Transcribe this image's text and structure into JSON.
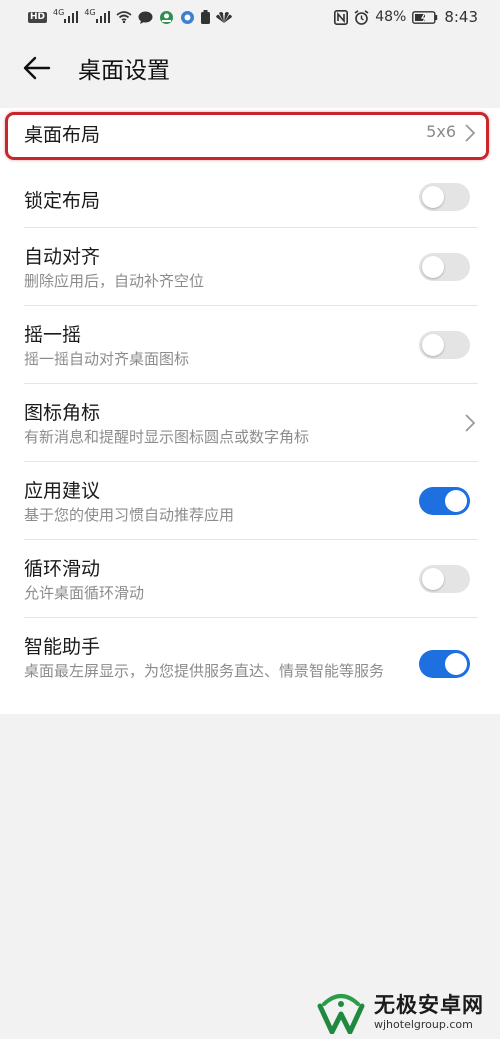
{
  "status_bar": {
    "left_icons": [
      "hd-icon",
      "signal-4g-icon",
      "signal-4g-icon",
      "wifi-icon",
      "chat-icon",
      "app-icon",
      "app-icon",
      "battery-saver-icon",
      "huawei-icon"
    ],
    "hd": "HD",
    "net1": "4G",
    "net2": "4G",
    "battery_percent": "48%",
    "time": "8:43"
  },
  "header": {
    "title": "桌面设置"
  },
  "settings": {
    "items": [
      {
        "label": "桌面布局",
        "value": "5x6",
        "control": "chevron"
      },
      {
        "label": "锁定布局",
        "control": "toggle",
        "on": false
      },
      {
        "label": "自动对齐",
        "desc": "删除应用后，自动补齐空位",
        "control": "toggle",
        "on": false
      },
      {
        "label": "摇一摇",
        "desc": "摇一摇自动对齐桌面图标",
        "control": "toggle",
        "on": false
      },
      {
        "label": "图标角标",
        "desc": "有新消息和提醒时显示图标圆点或数字角标",
        "control": "chevron"
      },
      {
        "label": "应用建议",
        "desc": "基于您的使用习惯自动推荐应用",
        "control": "toggle",
        "on": true
      },
      {
        "label": "循环滑动",
        "desc": "允许桌面循环滑动",
        "control": "toggle",
        "on": false
      },
      {
        "label": "智能助手",
        "desc": "桌面最左屏显示，为您提供服务直达、情景智能等服务",
        "control": "toggle",
        "on": true
      }
    ]
  },
  "colors": {
    "toggle_on": "#1e6fe0",
    "toggle_off": "#e4e4e4",
    "highlight": "#c9262c",
    "background": "#f2f2f2"
  },
  "watermark": {
    "title": "无极安卓网",
    "url": "wjhotelgroup.com"
  }
}
